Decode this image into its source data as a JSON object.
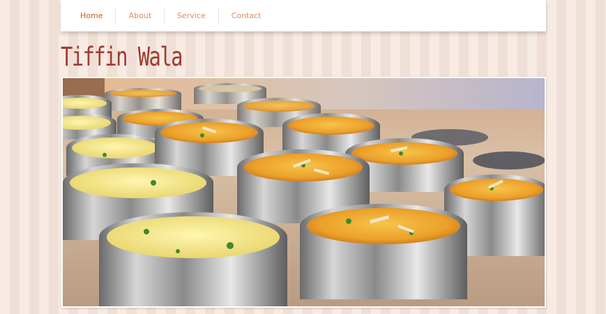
{
  "nav": {
    "items": [
      {
        "label": "Home",
        "active": true
      },
      {
        "label": "About",
        "active": false
      },
      {
        "label": "Service",
        "active": false
      },
      {
        "label": "Contact",
        "active": false
      }
    ]
  },
  "brand": {
    "logo_text": "Tiffin Wala"
  },
  "colors": {
    "accent": "#c85d1c",
    "nav_text": "#d98e5f",
    "logo": "#a23a30",
    "background": "#f4e3da"
  }
}
